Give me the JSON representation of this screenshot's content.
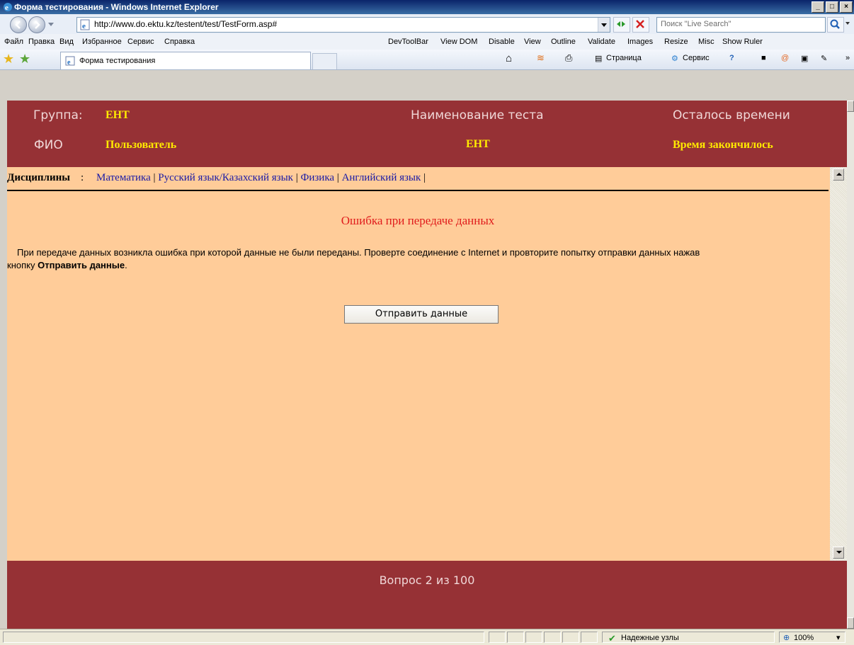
{
  "window": {
    "title": "Форма тестирования - Windows Internet Explorer"
  },
  "address": {
    "url": "http://www.do.ektu.kz/testent/test/TestForm.asp#"
  },
  "search": {
    "placeholder": "Поиск \"Live Search\""
  },
  "menu": {
    "items": [
      "Файл",
      "Правка",
      "Вид",
      "Избранное",
      "Сервис",
      "Справка"
    ],
    "devtools": [
      "DevToolBar",
      "View DOM",
      "Disable",
      "View",
      "Outline",
      "Validate",
      "Images",
      "Resize",
      "Misc",
      "Show Ruler"
    ]
  },
  "tab": {
    "label": "Форма тестирования"
  },
  "commands": {
    "page": "Страница",
    "tools": "Сервис"
  },
  "header": {
    "group_label": "Группа:",
    "group_value": "ЕНТ",
    "fio_label": "ФИО",
    "fio_value": "Пользователь",
    "test_name_label": "Наименование теста",
    "test_name_value": "ЕНТ",
    "time_label": "Осталось времени",
    "time_value": "Время закончилось"
  },
  "disciplines": {
    "label": "Дисциплины",
    "items": [
      "Математика",
      "Русский язык/Казахский язык",
      "Физика",
      "Английский язык"
    ]
  },
  "error": {
    "title": "Ошибка при передаче данных",
    "message_part1": "При передаче данных возникла ошибка при которой данные не были переданы. Проверте соединение с Internet и провторите попытку отправки данных нажав",
    "message_part2": "кнопку",
    "message_bold": "Отправить данные",
    "message_end": "."
  },
  "send_button": {
    "label": "Отправить данные"
  },
  "footer": {
    "question": "Вопрос 2 из 100"
  },
  "status": {
    "zone": "Надежные узлы",
    "zoom": "100%"
  },
  "colors": {
    "header_bg": "#963135",
    "content_bg": "#ffcc99",
    "accent_yellow": "#ffea00",
    "error_red": "#e01b1b"
  }
}
